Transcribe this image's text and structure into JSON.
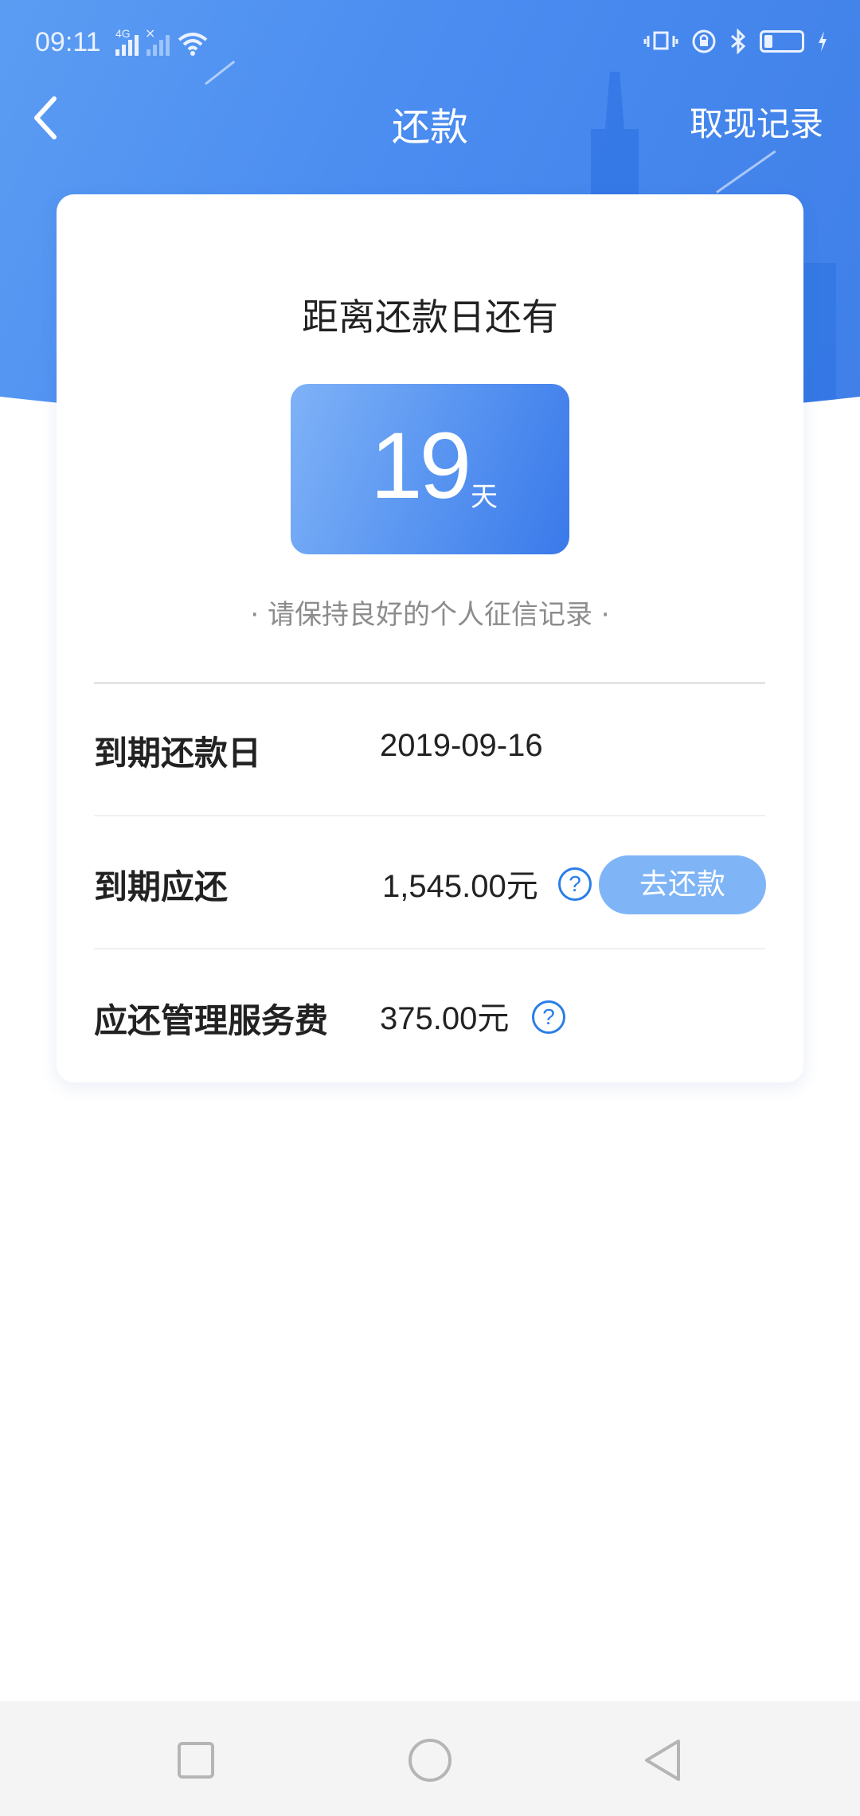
{
  "status_bar": {
    "time": "09:11",
    "network_label": "4G"
  },
  "nav": {
    "title": "还款",
    "action": "取现记录"
  },
  "countdown": {
    "label": "距离还款日还有",
    "days": "19",
    "unit": "天",
    "hint": "· 请保持良好的个人征信记录 ·"
  },
  "rows": [
    {
      "label": "到期还款日",
      "value": "2019-09-16"
    },
    {
      "label": "到期应还",
      "value": "1,545.00元"
    },
    {
      "label": "应还管理服务费",
      "value": "375.00元"
    }
  ],
  "help_glyph": "?",
  "pay_button": "去还款",
  "colors": {
    "header_blue": "#4a8cf0",
    "accent_blue": "#2a7ee8",
    "button_blue": "#7fb5f7"
  },
  "icons": [
    "back-arrow-icon",
    "signal-icon",
    "wifi-icon",
    "vibrate-icon",
    "rotation-lock-icon",
    "bluetooth-icon",
    "battery-icon",
    "help-icon",
    "square-nav-icon",
    "circle-nav-icon",
    "triangle-nav-icon"
  ]
}
